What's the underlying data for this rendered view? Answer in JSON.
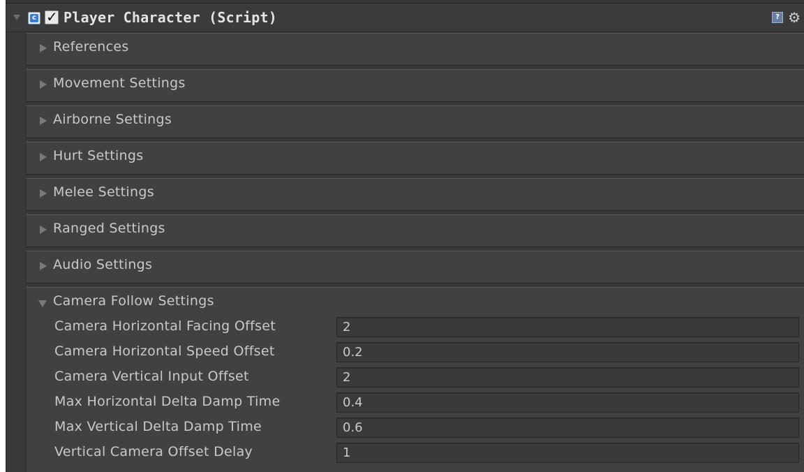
{
  "component": {
    "title": "Player Character (Script)",
    "enabled": true,
    "icons": {
      "foldout": "chevron-down-icon",
      "script": "script-icon",
      "help": "help-icon",
      "settings": "gear-icon"
    }
  },
  "sections": [
    {
      "label": "References",
      "expanded": false
    },
    {
      "label": "Movement Settings",
      "expanded": false
    },
    {
      "label": "Airborne Settings",
      "expanded": false
    },
    {
      "label": "Hurt Settings",
      "expanded": false
    },
    {
      "label": "Melee Settings",
      "expanded": false
    },
    {
      "label": "Ranged Settings",
      "expanded": false
    },
    {
      "label": "Audio Settings",
      "expanded": false
    },
    {
      "label": "Camera Follow Settings",
      "expanded": true
    }
  ],
  "camera_follow": {
    "fields": [
      {
        "label": "Camera Horizontal Facing Offset",
        "value": "2"
      },
      {
        "label": "Camera Horizontal Speed Offset",
        "value": "0.2"
      },
      {
        "label": "Camera Vertical Input Offset",
        "value": "2"
      },
      {
        "label": "Max Horizontal Delta Damp Time",
        "value": "0.4"
      },
      {
        "label": "Max Vertical Delta Damp Time",
        "value": "0.6"
      },
      {
        "label": "Vertical Camera Offset Delay",
        "value": "1"
      }
    ]
  },
  "colors": {
    "panel": "#383838",
    "section": "#414141",
    "text": "#c9c9c9",
    "script_icon": "#3a7cd2"
  }
}
